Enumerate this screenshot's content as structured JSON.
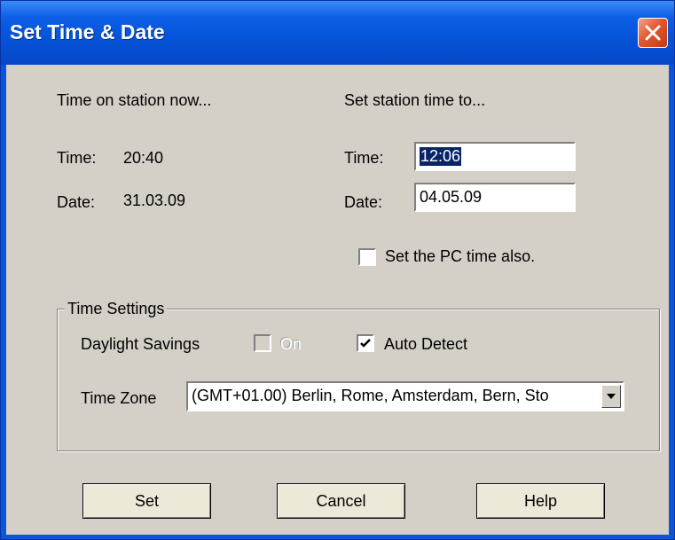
{
  "window": {
    "title": "Set Time & Date"
  },
  "left_panel": {
    "heading": "Time on station now...",
    "time_label": "Time:",
    "time_value": "20:40",
    "date_label": "Date:",
    "date_value": "31.03.09"
  },
  "right_panel": {
    "heading": "Set station time to...",
    "time_label": "Time:",
    "time_value": "12:06",
    "date_label": "Date:",
    "date_value": "04.05.09",
    "pc_time_label": "Set the PC time also.",
    "pc_time_checked": false
  },
  "time_settings": {
    "group_label": "Time Settings",
    "daylight_label": "Daylight Savings",
    "on_label": "On",
    "on_checked": false,
    "on_disabled": true,
    "auto_detect_label": "Auto Detect",
    "auto_detect_checked": true,
    "timezone_label": "Time Zone",
    "timezone_value": "(GMT+01.00) Berlin, Rome, Amsterdam, Bern, Sto"
  },
  "buttons": {
    "set": "Set",
    "cancel": "Cancel",
    "help": "Help"
  },
  "icons": {
    "close": "close-icon",
    "dropdown": "chevron-down-icon",
    "check": "checkmark-icon"
  },
  "colors": {
    "titlebar": "#0553d8",
    "dialog_bg": "#d4d0c8",
    "close_button": "#e2572e",
    "selection": "#0a246a"
  }
}
